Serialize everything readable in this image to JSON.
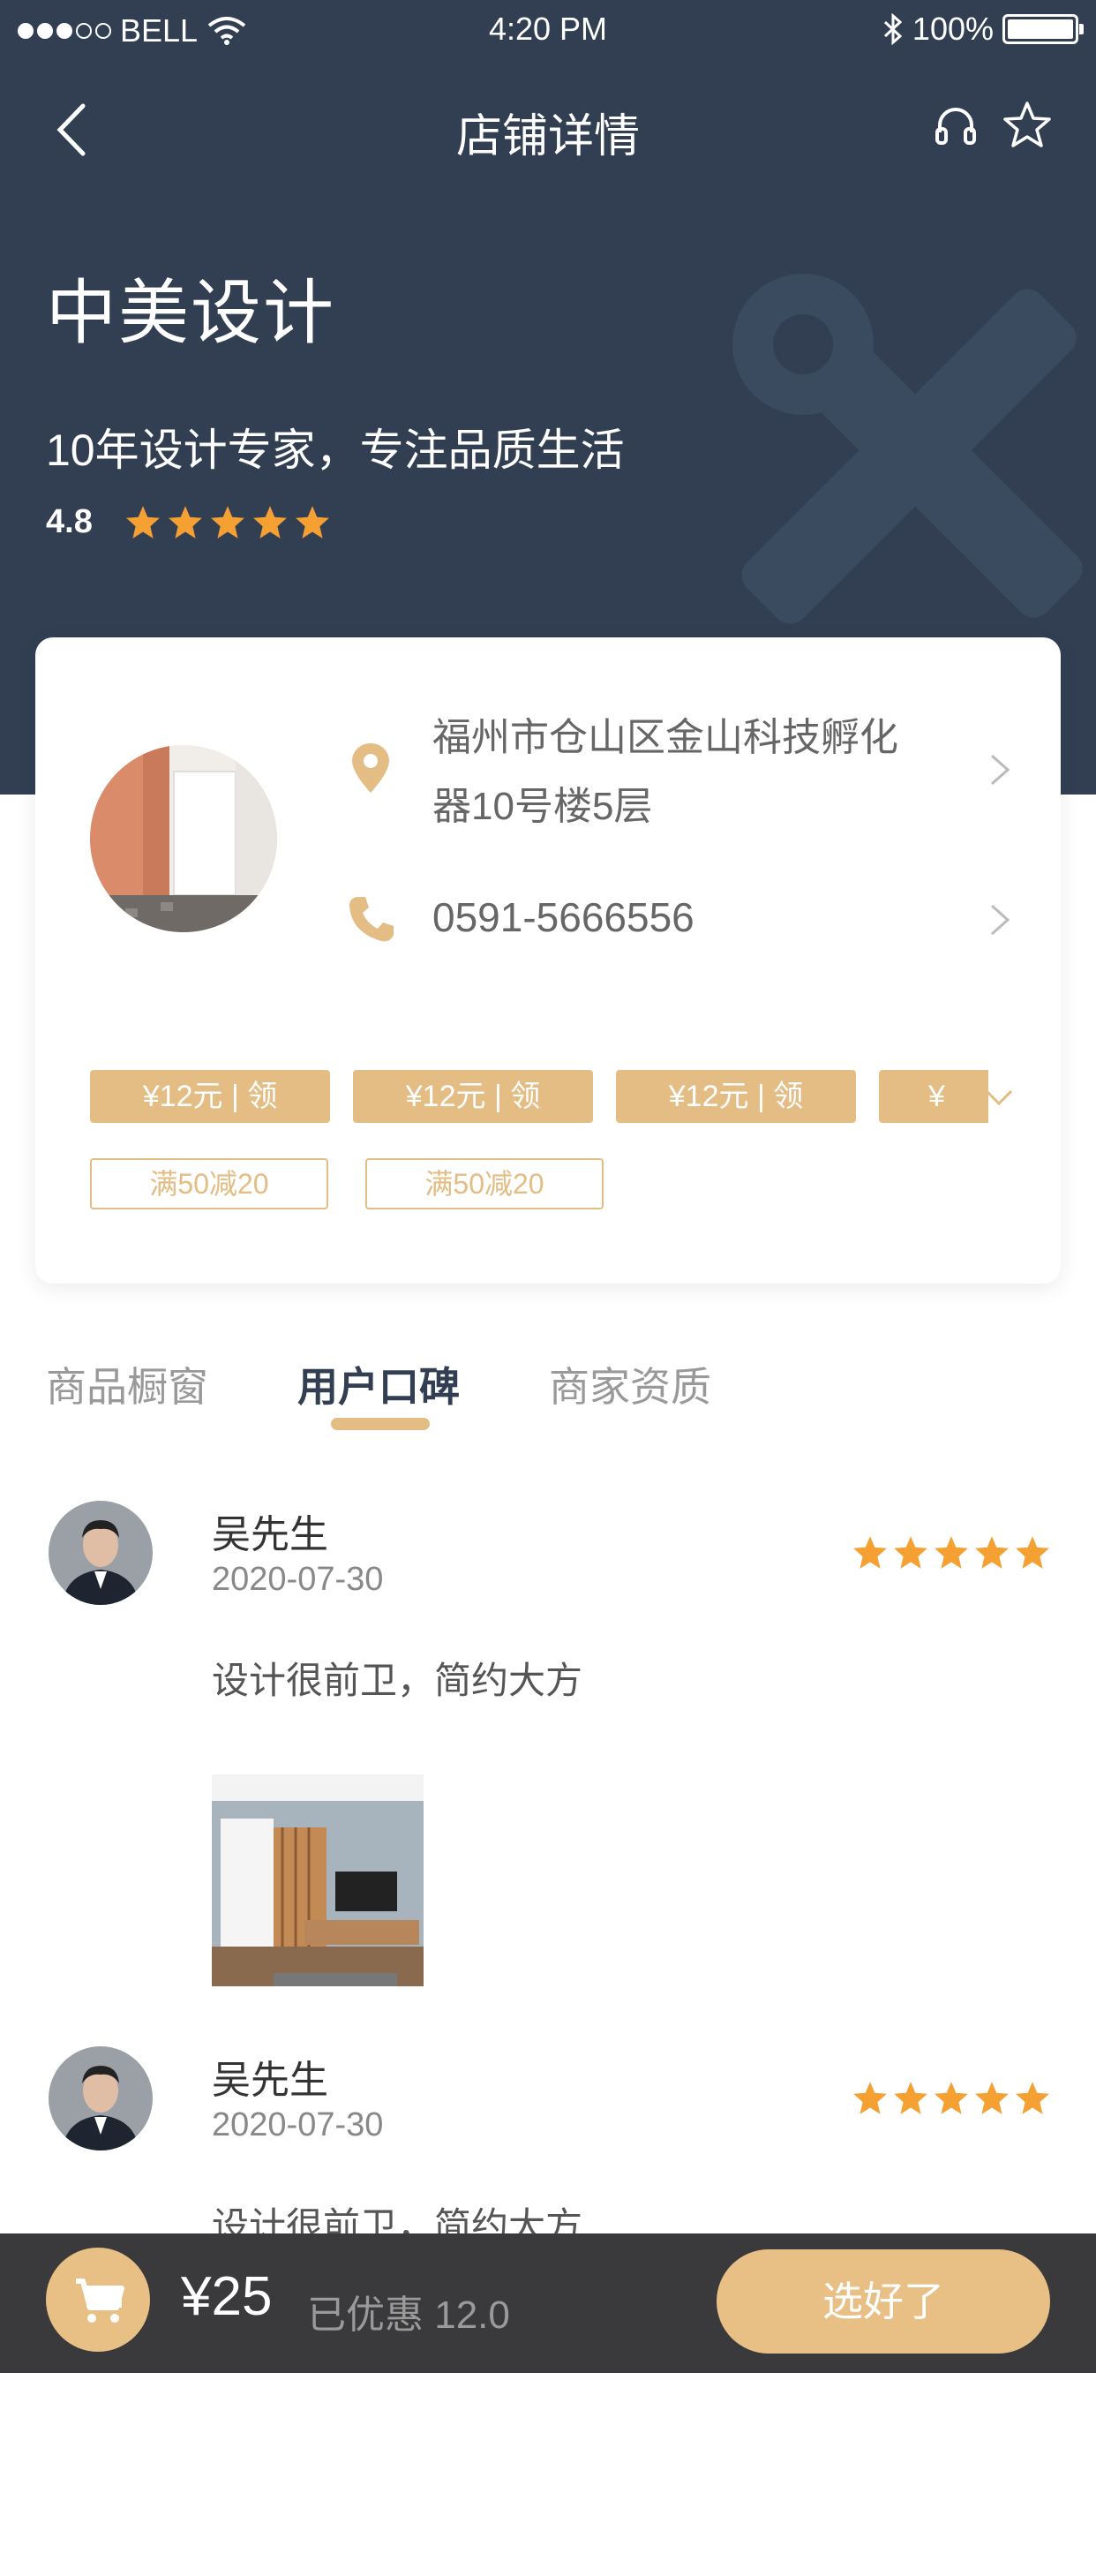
{
  "status_bar": {
    "carrier": "BELL",
    "time": "4:20 PM",
    "battery": "100%"
  },
  "nav": {
    "title": "店铺详情"
  },
  "shop": {
    "name": "中美设计",
    "slogan": "10年设计专家，专注品质生活",
    "rating": "4.8",
    "rating_stars": 5,
    "address": "福州市仓山区金山科技孵化器10号楼5层",
    "phone": "0591-5666556"
  },
  "coupons": [
    {
      "label": "¥12元 | 领"
    },
    {
      "label": "¥12元 | 领"
    },
    {
      "label": "¥12元 | 领"
    },
    {
      "label": "¥"
    }
  ],
  "promotions": [
    {
      "label": "满50减20"
    },
    {
      "label": "满50减20"
    }
  ],
  "tabs": [
    {
      "label": "商品橱窗"
    },
    {
      "label": "用户口碑"
    },
    {
      "label": "商家资质"
    }
  ],
  "active_tab": "用户口碑",
  "reviews": [
    {
      "name": "吴先生",
      "date": "2020-07-30",
      "stars": 5,
      "text": "设计很前卫，简约大方"
    },
    {
      "name": "吴先生",
      "date": "2020-07-30",
      "stars": 5,
      "text": "设计很前卫，简约大方"
    }
  ],
  "bottom_bar": {
    "price": "¥25",
    "discount": "已优惠 12.0",
    "button": "选好了"
  },
  "colors": {
    "header_bg": "#323f52",
    "accent": "#e3bd84",
    "star": "#f5a033",
    "bottom_bar": "#3a3a3c"
  }
}
